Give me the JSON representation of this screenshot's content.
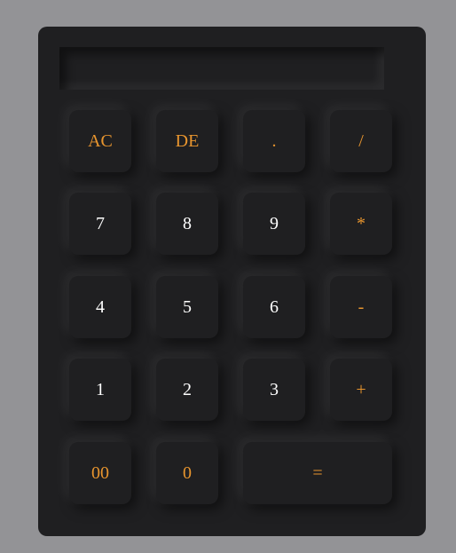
{
  "calculator": {
    "display_value": "",
    "buttons": {
      "ac": "AC",
      "de": "DE",
      "dot": ".",
      "divide": "/",
      "seven": "7",
      "eight": "8",
      "nine": "9",
      "multiply": "*",
      "four": "4",
      "five": "5",
      "six": "6",
      "subtract": "-",
      "one": "1",
      "two": "2",
      "three": "3",
      "add": "+",
      "double_zero": "00",
      "zero": "0",
      "equals": "="
    }
  },
  "colors": {
    "page_background": "#939396",
    "calculator_body": "#1f1f21",
    "digit_text": "#ffffff",
    "operator_text": "#e8952e"
  }
}
